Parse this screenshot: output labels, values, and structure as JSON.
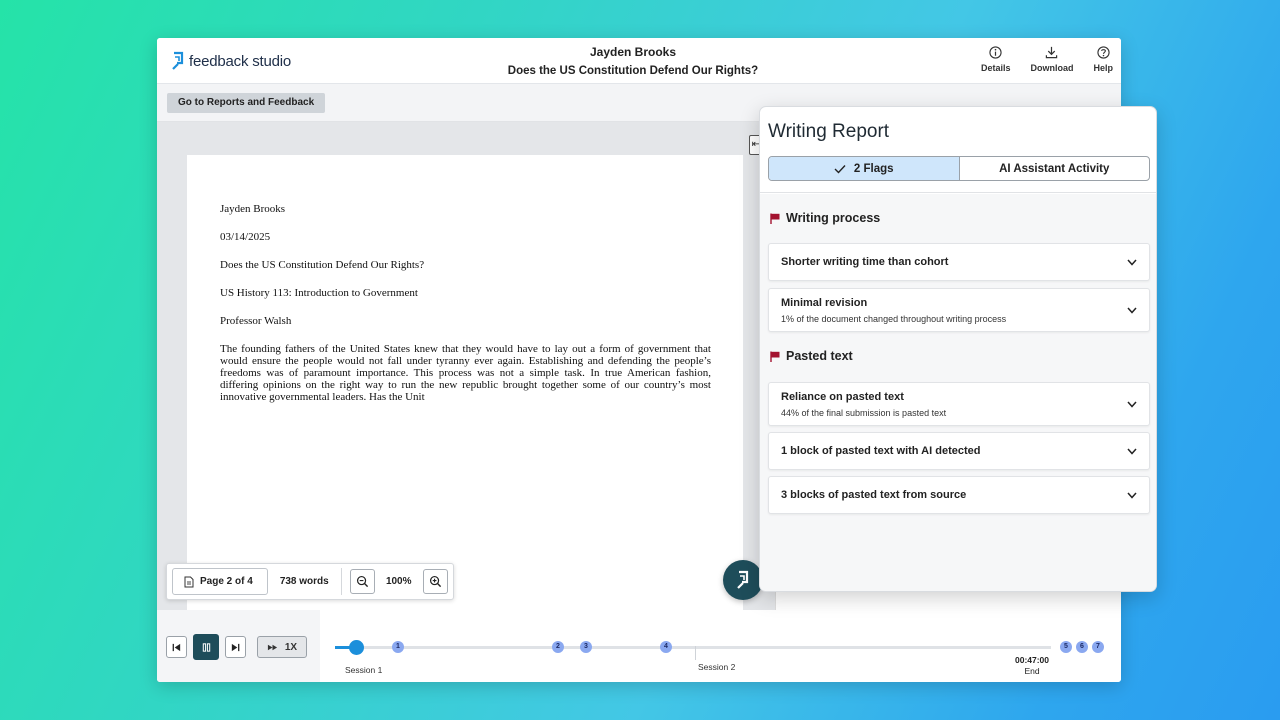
{
  "app": {
    "logo_text": "feedback studio"
  },
  "header": {
    "student_name": "Jayden Brooks",
    "assignment_title": "Does the US Constitution Defend Our Rights?",
    "actions": [
      {
        "label": "Details",
        "icon": "info-icon"
      },
      {
        "label": "Download",
        "icon": "download-icon"
      },
      {
        "label": "Help",
        "icon": "help-icon"
      }
    ]
  },
  "subbar": {
    "reports_button": "Go to Reports and Feedback"
  },
  "document": {
    "lines": [
      "Jayden Brooks",
      "03/14/2025",
      "Does the US Constitution Defend Our Rights?",
      "US History 113: Introduction to Government",
      "Professor Walsh"
    ],
    "paragraph": "The founding fathers of the United States knew that they would have to lay out a form of government that would ensure the people would not fall under tyranny ever again. Establishing and defending the people’s freedoms was of paramount importance. This process was not a simple task. In true American fashion, differing opinions on the right way to run the new republic brought together some of our country’s most innovative governmental leaders. Has the Unit"
  },
  "doc_toolbar": {
    "page": "Page 2 of 4",
    "words": "738 words",
    "zoom": "100%"
  },
  "player": {
    "speed": "1X",
    "progress": 0.03,
    "markers": [
      "1",
      "2",
      "3",
      "4",
      "5",
      "6",
      "7"
    ],
    "sessions": [
      "Session 1",
      "Session 2"
    ],
    "end_time": "00:47:00",
    "end_label": "End"
  },
  "report": {
    "title": "Writing Report",
    "tabs": [
      "2 Flags",
      "AI Assistant Activity"
    ],
    "sections": [
      {
        "title": "Writing process",
        "items": [
          {
            "title": "Shorter writing time than cohort",
            "subtitle": ""
          },
          {
            "title": "Minimal revision",
            "subtitle": "1% of the document changed throughout writing process"
          }
        ]
      },
      {
        "title": "Pasted text",
        "items": [
          {
            "title": "Reliance on pasted text",
            "subtitle": "44% of the final submission is pasted text"
          },
          {
            "title": "1 block of pasted text with AI detected",
            "subtitle": ""
          },
          {
            "title": "3 blocks of pasted text from source",
            "subtitle": ""
          }
        ]
      }
    ]
  },
  "colors": {
    "brand_dark": "#1e4d5a",
    "accent_blue": "#1c8fdb",
    "flag_red": "#a3122f",
    "tab_active": "#cfe6fb"
  }
}
